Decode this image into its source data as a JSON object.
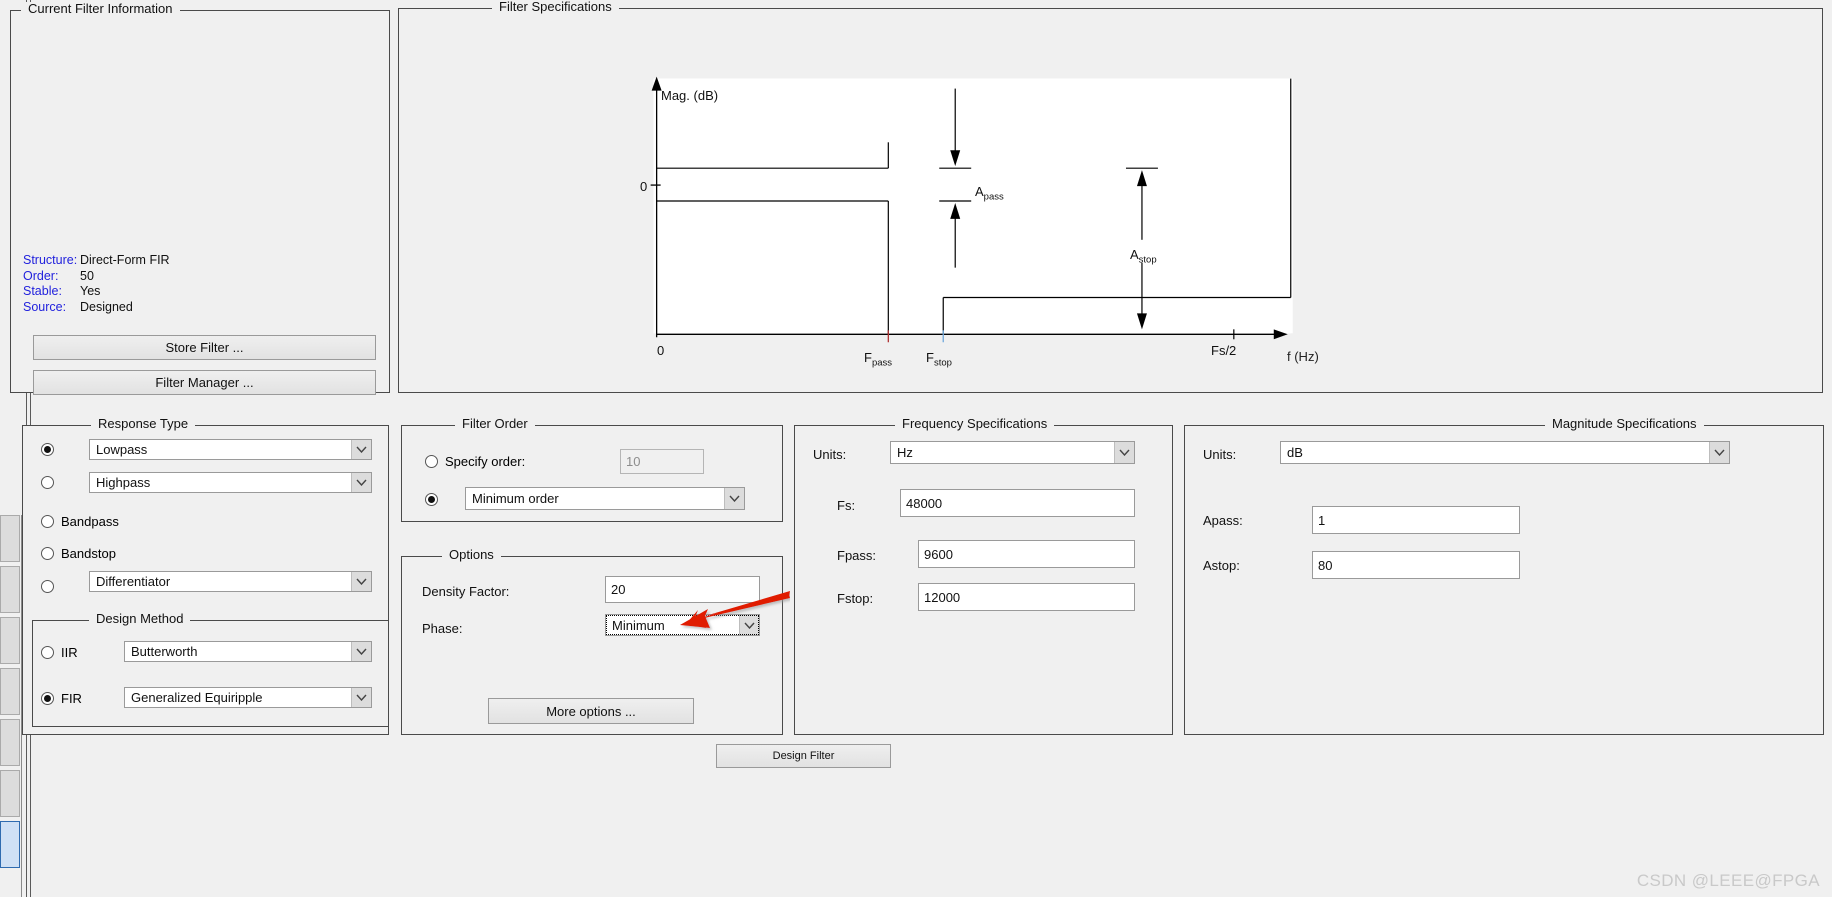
{
  "app": {
    "watermark": "CSDN @LEEE@FPGA"
  },
  "filter_info": {
    "legend": "Current Filter Information",
    "rows": [
      {
        "key": "Structure:",
        "value": "Direct-Form FIR"
      },
      {
        "key": "Order:",
        "value": "50"
      },
      {
        "key": "Stable:",
        "value": "Yes"
      },
      {
        "key": "Source:",
        "value": "Designed"
      }
    ],
    "store_filter_label": "Store Filter ...",
    "filter_manager_label": "Filter Manager ..."
  },
  "filter_spec": {
    "legend": "Filter Specifications",
    "y_axis_label": "Mag. (dB)",
    "y_zero_label": "0",
    "x_axis_label": "f (Hz)",
    "x_origin_label": "0",
    "x_tick_fpass": "F",
    "x_tick_fpass_sub": "pass",
    "x_tick_fstop": "F",
    "x_tick_fstop_sub": "stop",
    "x_tick_nyquist": "Fs/2",
    "annot_apass": "A",
    "annot_apass_sub": "pass",
    "annot_astop": "A",
    "annot_astop_sub": "stop"
  },
  "response_type": {
    "legend": "Response Type",
    "items": [
      {
        "label": "Lowpass",
        "type": "combo",
        "selected": true
      },
      {
        "label": "Highpass",
        "type": "combo",
        "selected": false
      },
      {
        "label": "Bandpass",
        "type": "radio",
        "selected": false
      },
      {
        "label": "Bandstop",
        "type": "radio",
        "selected": false
      },
      {
        "label": "Differentiator",
        "type": "combo",
        "selected": false
      }
    ]
  },
  "design_method": {
    "legend": "Design Method",
    "iir": {
      "label": "IIR",
      "value": "Butterworth",
      "selected": false
    },
    "fir": {
      "label": "FIR",
      "value": "Generalized Equiripple",
      "selected": true
    }
  },
  "filter_order": {
    "legend": "Filter Order",
    "specify_order_label": "Specify order:",
    "specify_order_selected": false,
    "specify_order_value": "10",
    "minimum_order_value": "Minimum order",
    "minimum_order_selected": true
  },
  "options": {
    "legend": "Options",
    "density_factor_label": "Density Factor:",
    "density_factor_value": "20",
    "phase_label": "Phase:",
    "phase_value": "Minimum",
    "more_options_label": "More options ..."
  },
  "frequency_spec": {
    "legend": "Frequency Specifications",
    "units_label": "Units:",
    "units_value": "Hz",
    "fields": [
      {
        "label": "Fs:",
        "value": "48000"
      },
      {
        "label": "Fpass:",
        "value": "9600"
      },
      {
        "label": "Fstop:",
        "value": "12000"
      }
    ]
  },
  "magnitude_spec": {
    "legend": "Magnitude Specifications",
    "units_label": "Units:",
    "units_value": "dB",
    "fields": [
      {
        "label": "Apass:",
        "value": "1"
      },
      {
        "label": "Astop:",
        "value": "80"
      }
    ]
  },
  "actions": {
    "design_filter_label": "Design Filter"
  },
  "colors": {
    "info_key": "#2222dd",
    "annotation_arrow": "#e01b00",
    "panel_bg": "#f0f0f0",
    "plot_bg": "#ffffff"
  }
}
